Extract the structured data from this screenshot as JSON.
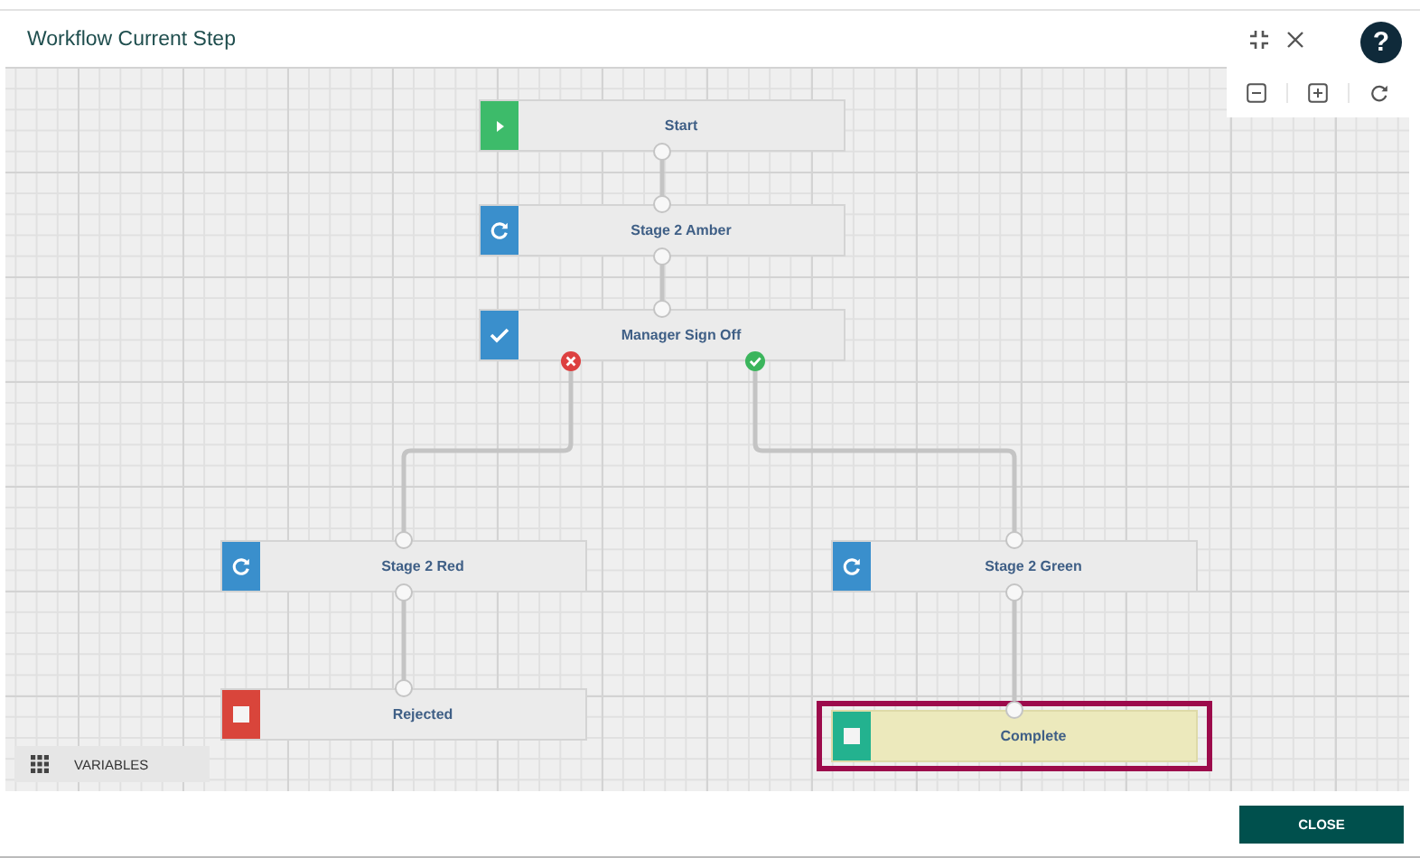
{
  "window": {
    "title": "Workflow Current Step"
  },
  "help_button": {
    "label": "?"
  },
  "nodes": [
    {
      "label": "Start",
      "kind": "start",
      "color": "#3dbb6a",
      "selected": false
    },
    {
      "label": "Stage 2 Amber",
      "kind": "loop",
      "color": "#3a8fcc",
      "selected": false
    },
    {
      "label": "Manager Sign Off",
      "kind": "approval",
      "color": "#3a8fcc",
      "selected": false
    },
    {
      "label": "Stage 2 Red",
      "kind": "loop",
      "color": "#3a8fcc",
      "selected": false
    },
    {
      "label": "Rejected",
      "kind": "end",
      "color": "#d9453b",
      "selected": false
    },
    {
      "label": "Stage 2 Green",
      "kind": "loop",
      "color": "#3a8fcc",
      "selected": false
    },
    {
      "label": "Complete",
      "kind": "end",
      "color": "#23b28f",
      "selected": true
    }
  ],
  "variables_button": {
    "label": "VARIABLES"
  },
  "close_button": {
    "label": "CLOSE"
  }
}
